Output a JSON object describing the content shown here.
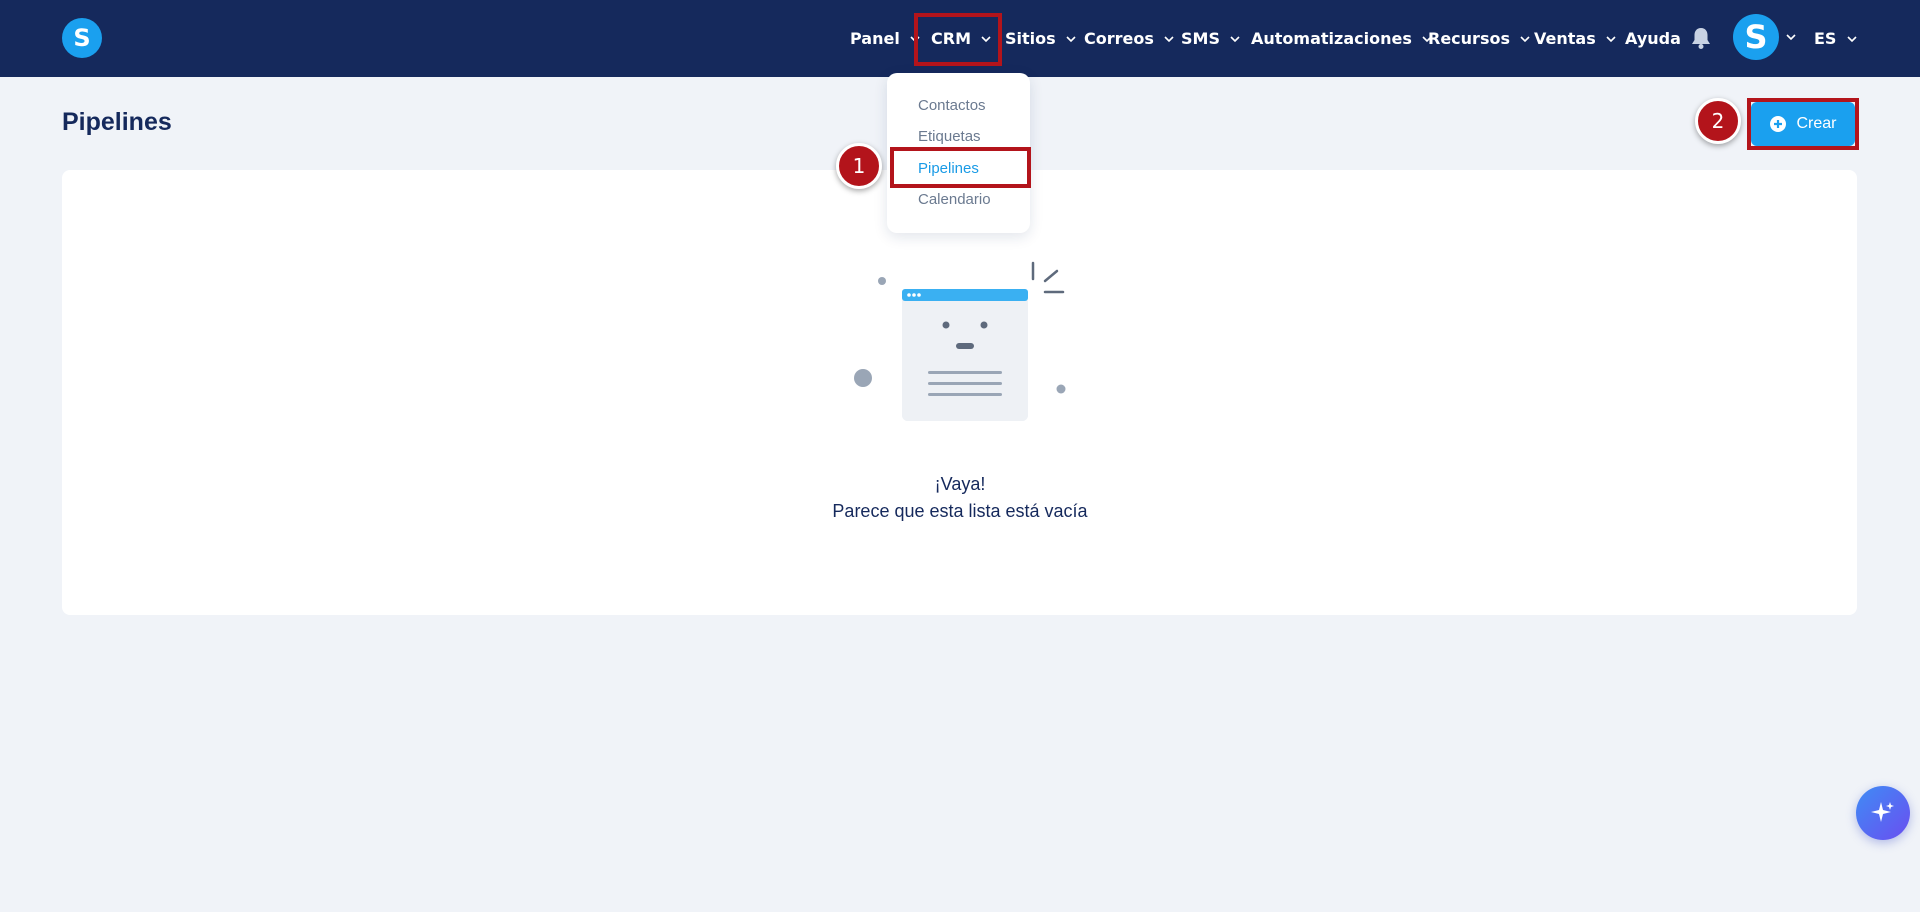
{
  "app": {
    "logo_letter": "S",
    "avatar_letter": "S",
    "language": "ES"
  },
  "nav": {
    "items": [
      {
        "label": "Panel"
      },
      {
        "label": "CRM"
      },
      {
        "label": "Sitios"
      },
      {
        "label": "Correos"
      },
      {
        "label": "SMS"
      },
      {
        "label": "Automatizaciones"
      },
      {
        "label": "Recursos"
      },
      {
        "label": "Ventas"
      },
      {
        "label": "Ayuda"
      }
    ]
  },
  "crm_menu": {
    "items": [
      {
        "label": "Contactos"
      },
      {
        "label": "Etiquetas"
      },
      {
        "label": "Pipelines"
      },
      {
        "label": "Calendario"
      }
    ]
  },
  "page": {
    "title": "Pipelines",
    "create_button": "Crear"
  },
  "empty_state": {
    "title": "¡Vaya!",
    "message": "Parece que esta lista está vacía"
  },
  "annotations": {
    "step1": "1",
    "step2": "2"
  },
  "colors": {
    "topbar": "#15295c",
    "brand": "#1aa0ef",
    "highlight": "#b3141b",
    "background": "#f0f3f8"
  }
}
